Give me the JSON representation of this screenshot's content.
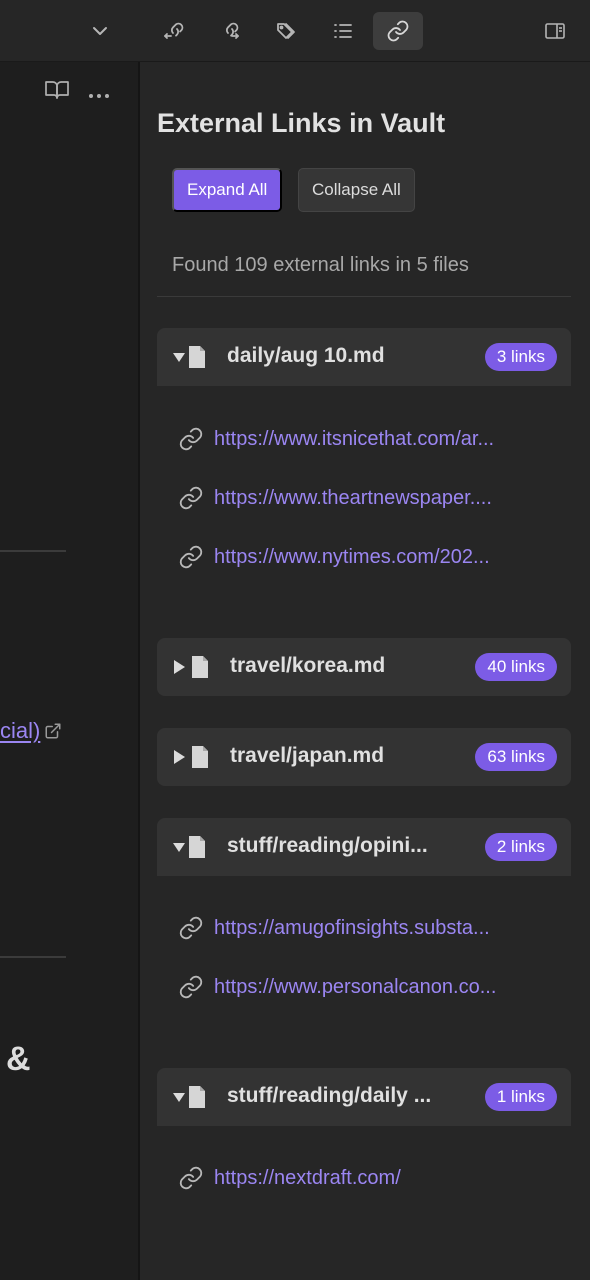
{
  "toolbar": {
    "icons": [
      "chevron-down-icon",
      "backlinks-icon",
      "outgoing-links-icon",
      "tags-icon",
      "outline-icon",
      "external-links-icon",
      "sidebar-toggle-icon"
    ]
  },
  "editor": {
    "link_fragment": "cial)",
    "ampersand": "&"
  },
  "sidebar": {
    "title": "External Links in Vault",
    "expand_all": "Expand All",
    "collapse_all": "Collapse All",
    "summary": "Found 109 external links in 5 files",
    "groups": [
      {
        "file": "daily/aug 10.md",
        "badge": "3 links",
        "expanded": true,
        "links": [
          "https://www.itsnicethat.com/ar...",
          "https://www.theartnewspaper....",
          "https://www.nytimes.com/202..."
        ]
      },
      {
        "file": "travel/korea.md",
        "badge": "40 links",
        "expanded": false,
        "links": []
      },
      {
        "file": "travel/japan.md",
        "badge": "63 links",
        "expanded": false,
        "links": []
      },
      {
        "file": "stuff/reading/opini...",
        "badge": "2 links",
        "expanded": true,
        "links": [
          "https://amugofinsights.substa...",
          "https://www.personalcanon.co..."
        ]
      },
      {
        "file": "stuff/reading/daily ...",
        "badge": "1 links",
        "expanded": true,
        "links": [
          "https://nextdraft.com/"
        ]
      }
    ]
  },
  "colors": {
    "accent": "#7c5ce6",
    "link": "#9b86f2",
    "panel": "#262626",
    "editor": "#1e1e1e"
  }
}
